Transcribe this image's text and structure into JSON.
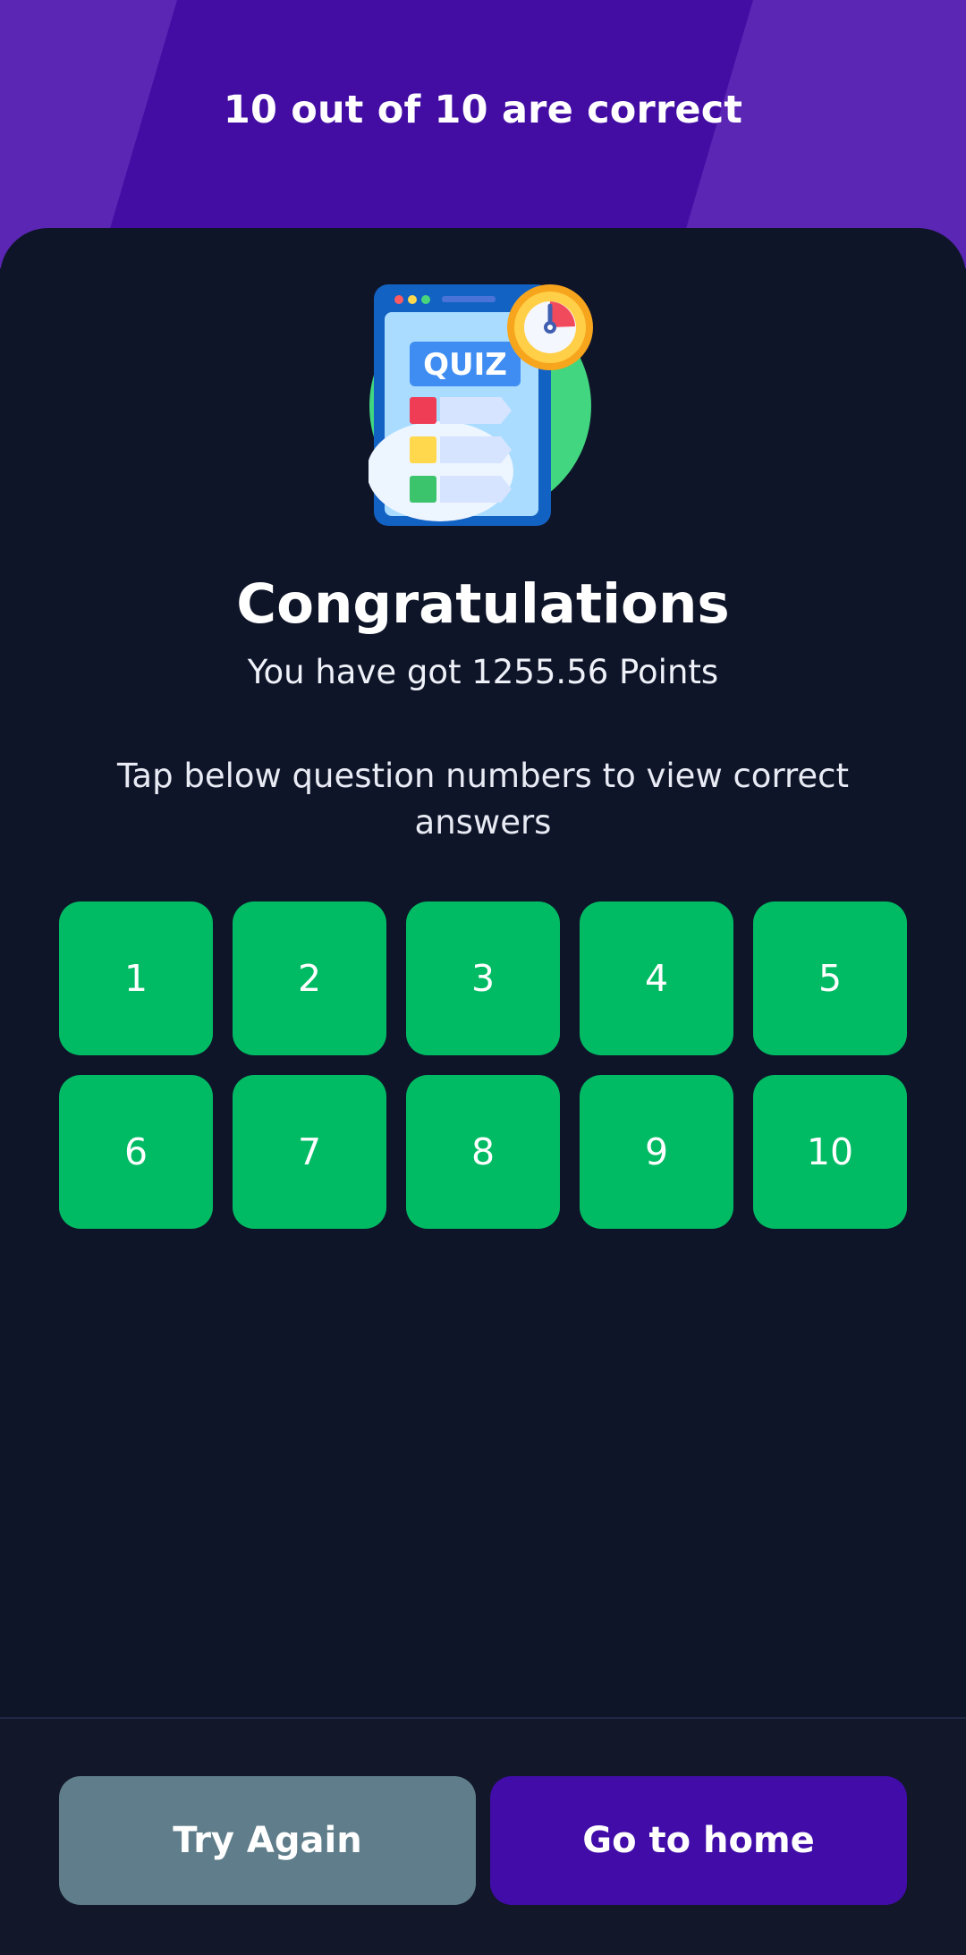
{
  "header": {
    "title": "10 out of 10 are correct"
  },
  "result": {
    "illustration_icon": "quiz-timer-illustration-icon",
    "illustration_text": "QUIZ",
    "heading": "Congratulations",
    "points_text": "You have got 1255.56 Points",
    "instructions": "Tap below question numbers to view correct answers"
  },
  "questions": [
    "1",
    "2",
    "3",
    "4",
    "5",
    "6",
    "7",
    "8",
    "9",
    "10"
  ],
  "footer": {
    "try_again_label": "Try Again",
    "go_home_label": "Go to home"
  },
  "colors": {
    "header_bg": "#5a26b3",
    "header_band": "#430da4",
    "panel_bg": "#0f1529",
    "correct_green": "#00bb63",
    "try_again_bg": "#5f7d8a",
    "home_button_bg": "#410ca8"
  }
}
